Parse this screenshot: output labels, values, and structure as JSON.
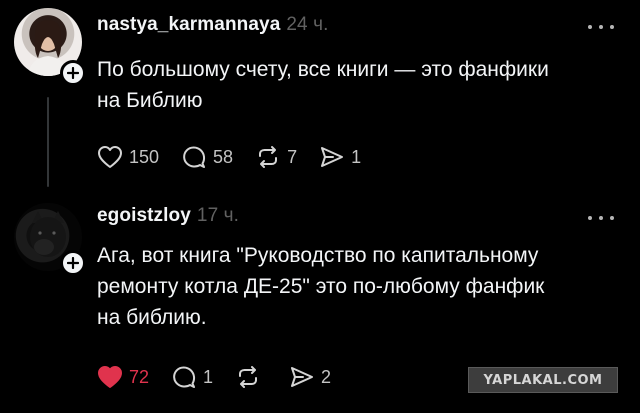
{
  "posts": [
    {
      "username": "nastya_karmannaya",
      "time": "24 ч.",
      "text": "По большому счету, все книги — это фанфики\nна Библию",
      "likes": "150",
      "comments": "58",
      "reposts": "7",
      "shares": "1",
      "liked": false
    },
    {
      "username": "egoistzloy",
      "time": "17 ч.",
      "text": "Ага, вот книга \"Руководство по капитальному\nремонту котла ДЕ-25\" это по-любому фанфик\nна библию.",
      "likes": "72",
      "comments": "1",
      "reposts": "",
      "shares": "2",
      "liked": true
    }
  ],
  "icons": {
    "like": "heart-icon",
    "comment": "comment-bubble-icon",
    "repost": "repost-icon",
    "share": "send-icon",
    "more": "more-dots-icon",
    "follow": "plus-icon"
  },
  "colors": {
    "background": "#000000",
    "text": "#f3f5f7",
    "muted": "#616161",
    "liked": "#e0334d"
  },
  "watermark": "YAPLAKAL.COM"
}
